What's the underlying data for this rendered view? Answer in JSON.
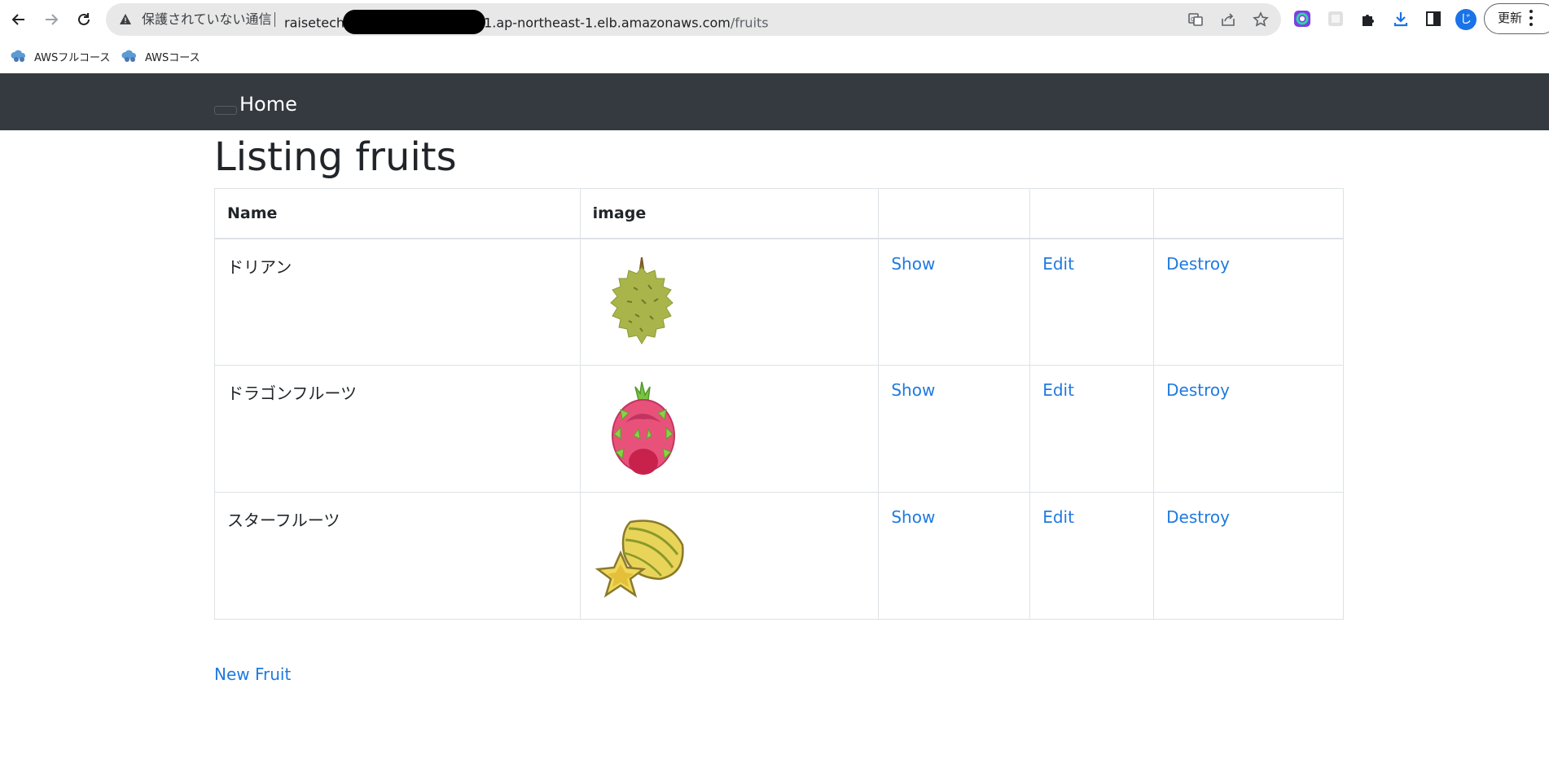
{
  "browser": {
    "security_status": "保護されていない通信",
    "url_prefix": "raisetech",
    "url_host_tail": "1.ap-northeast-1.elb.amazonaws.com",
    "url_path": "/fruits",
    "update_button": "更新",
    "profile_initial": "じ",
    "bookmarks": [
      {
        "label": "AWSフルコース"
      },
      {
        "label": "AWSコース"
      }
    ]
  },
  "navbar": {
    "brand": "Home"
  },
  "page": {
    "title": "Listing fruits",
    "new_link": "New Fruit"
  },
  "table": {
    "headers": {
      "name": "Name",
      "image": "image"
    },
    "rows": [
      {
        "name": "ドリアン",
        "image": "durian-image",
        "show": "Show",
        "edit": "Edit",
        "destroy": "Destroy"
      },
      {
        "name": "ドラゴンフルーツ",
        "image": "dragon-fruit-image",
        "show": "Show",
        "edit": "Edit",
        "destroy": "Destroy"
      },
      {
        "name": "スターフルーツ",
        "image": "star-fruit-image",
        "show": "Show",
        "edit": "Edit",
        "destroy": "Destroy"
      }
    ]
  },
  "colors": {
    "navbar_bg": "#343a40",
    "link": "#1f7ae0",
    "border": "#dee2e6",
    "omnibox_bg": "#e8e8e8"
  }
}
